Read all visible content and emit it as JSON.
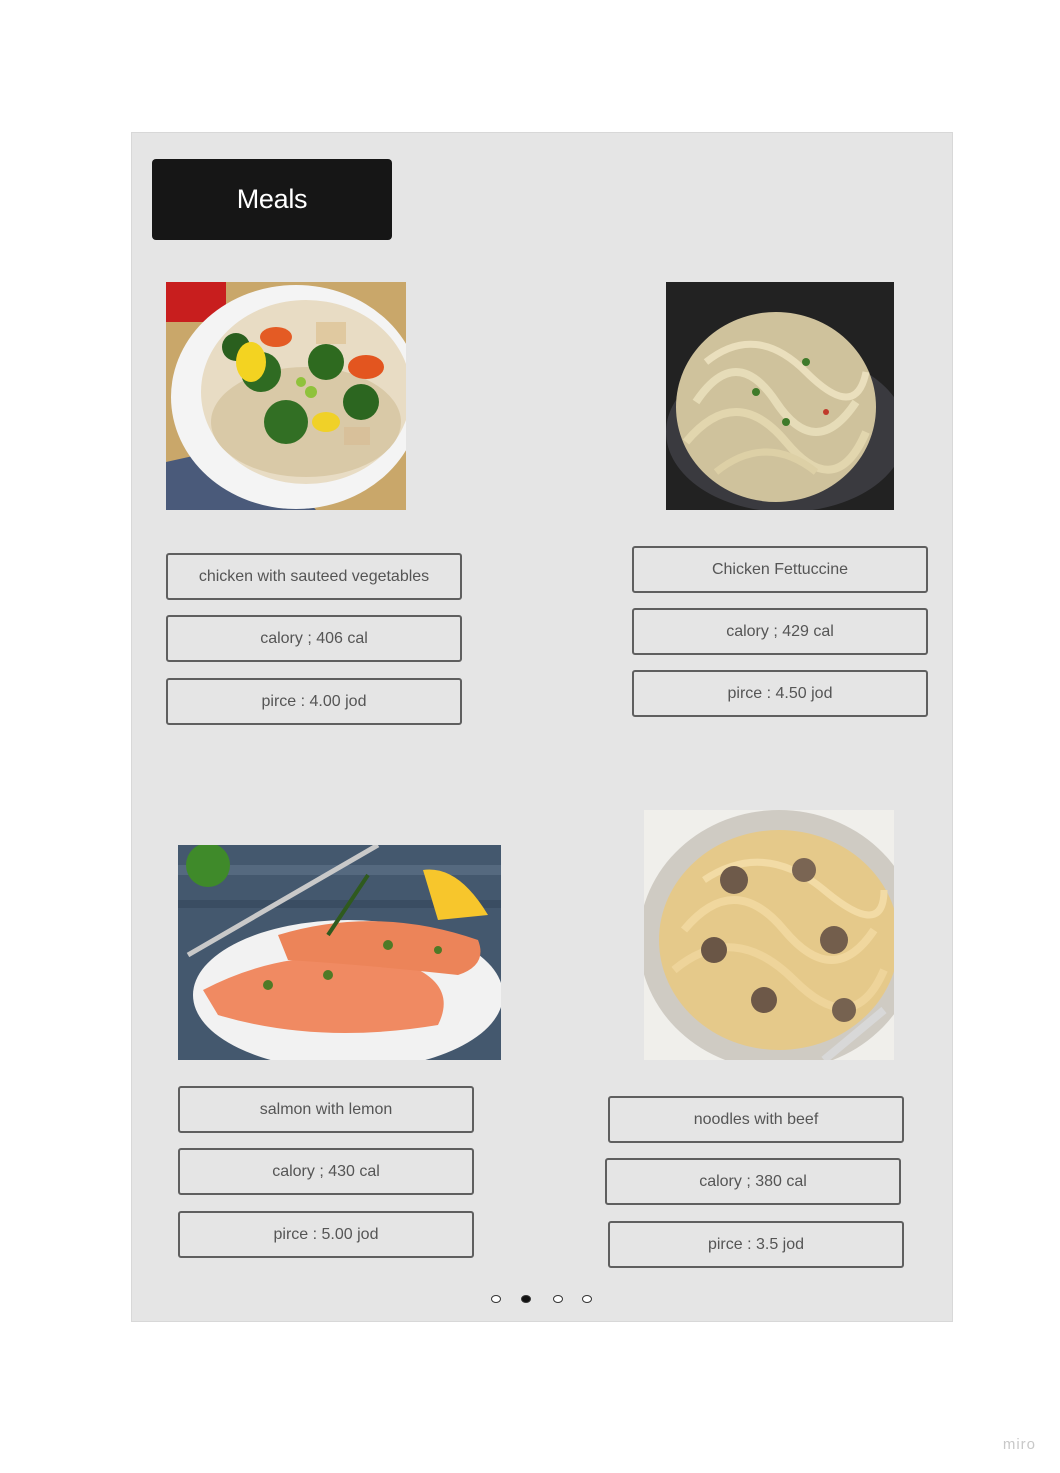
{
  "header": {
    "title": "Meals"
  },
  "meals": [
    {
      "name": "chicken with sauteed vegetables",
      "calories": "calory ; 406 cal",
      "price": "pirce : 4.00 jod",
      "image_icon": "rice-bowl-vegetables-image"
    },
    {
      "name": "Chicken Fettuccine",
      "calories": "calory ; 429 cal",
      "price": "pirce : 4.50 jod",
      "image_icon": "fettuccine-pasta-image"
    },
    {
      "name": "salmon with lemon",
      "calories": "calory ; 430 cal",
      "price": "pirce : 5.00 jod",
      "image_icon": "salmon-plate-image"
    },
    {
      "name": "noodles with beef",
      "calories": "calory ; 380 cal",
      "price": "pirce : 3.5 jod",
      "image_icon": "noodles-mushroom-image"
    }
  ],
  "pagination": {
    "pages": 4,
    "active_index": 1
  },
  "watermark": "miro"
}
